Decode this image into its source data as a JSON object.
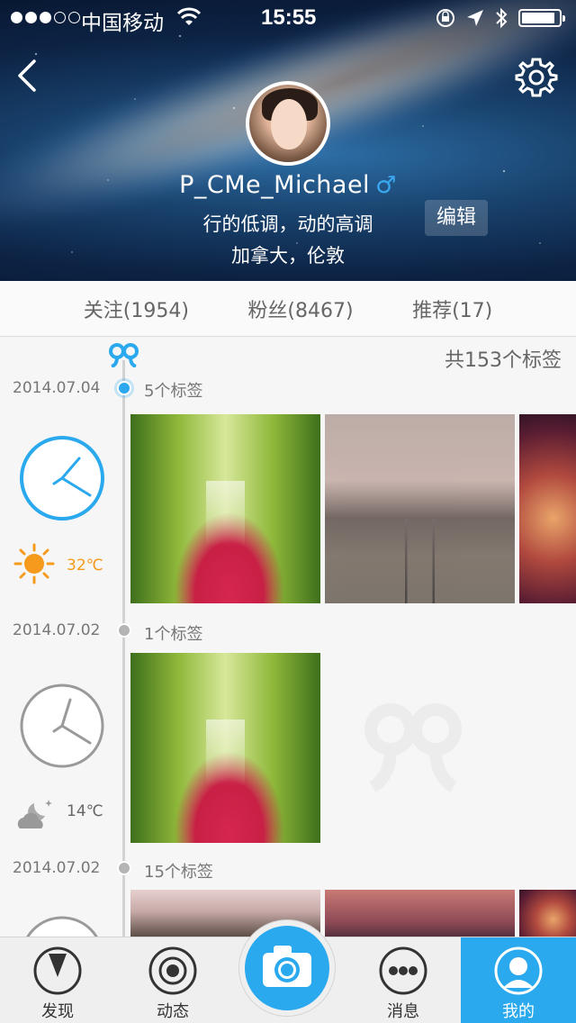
{
  "status_bar": {
    "carrier": "中国移动",
    "time": "15:55"
  },
  "profile": {
    "username": "P_CMe_Michael",
    "gender_symbol": "♂",
    "bio_line1": "行的低调，动的高调",
    "bio_line2": "加拿大，伦敦",
    "edit_label": "编辑"
  },
  "stats": {
    "following": "关注(1954)",
    "fans": "粉丝(8467)",
    "recommend": "推荐(17)"
  },
  "timeline": {
    "total_label": "共153个标签",
    "entries": [
      {
        "date": "2014.07.04",
        "tag_count": "5个标签",
        "temperature": "32℃",
        "weather_icon": "sun-icon",
        "active": true
      },
      {
        "date": "2014.07.02",
        "tag_count": "1个标签",
        "temperature": "14℃",
        "weather_icon": "cloud-moon-icon",
        "active": false
      },
      {
        "date": "2014.07.02",
        "tag_count": "15个标签",
        "temperature": "",
        "weather_icon": "",
        "active": false
      }
    ]
  },
  "tabbar": {
    "tabs": [
      {
        "label": "发现",
        "icon": "compass-icon"
      },
      {
        "label": "动态",
        "icon": "record-icon"
      },
      {
        "label": "",
        "icon": "camera-icon"
      },
      {
        "label": "消息",
        "icon": "more-dots-icon"
      },
      {
        "label": "我的",
        "icon": "user-icon"
      }
    ],
    "active_tab": "我的"
  },
  "colors": {
    "accent": "#2aa9ee",
    "sun": "#f59a1d"
  }
}
